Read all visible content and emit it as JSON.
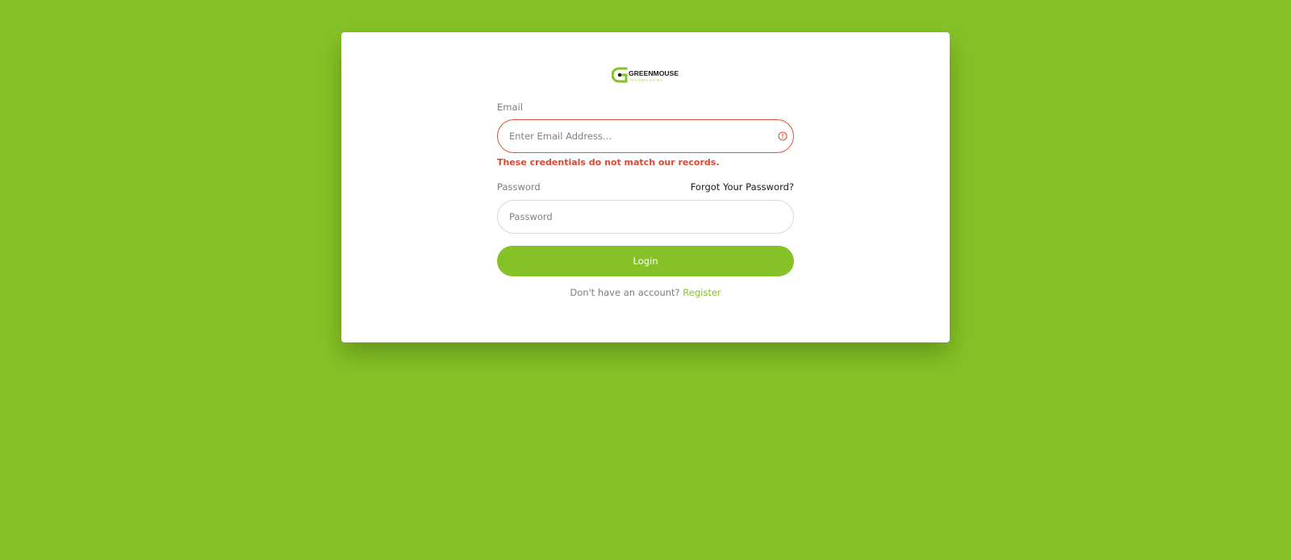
{
  "brand": {
    "name": "GREENMOUSE",
    "tagline": "TECHNOLOGIES",
    "logo_icon": "greenmouse-logo-icon"
  },
  "colors": {
    "background": "#86c227",
    "accent": "#86c227",
    "error": "#e2452f",
    "card": "#ffffff"
  },
  "form": {
    "email_label": "Email",
    "email_placeholder": "Enter Email Address...",
    "email_value": "",
    "email_error_icon": "exclamation-circle-icon",
    "error_message": "These credentials do not match our records.",
    "password_label": "Password",
    "password_placeholder": "Password",
    "password_value": "",
    "forgot_link": "Forgot Your Password?",
    "login_button": "Login",
    "register_prompt": "Don't have an account?",
    "register_link": "Register"
  }
}
